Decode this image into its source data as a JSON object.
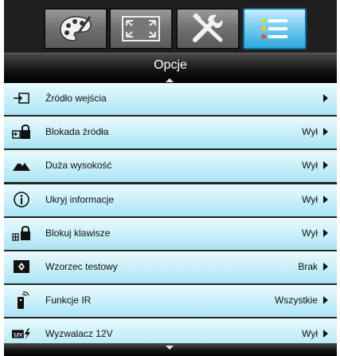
{
  "tabs": [
    {
      "name": "image-settings-tab",
      "icon": "palette-icon",
      "active": false
    },
    {
      "name": "display-tab",
      "icon": "screen-frame-icon",
      "active": false
    },
    {
      "name": "setup-tab",
      "icon": "tools-icon",
      "active": false
    },
    {
      "name": "options-tab",
      "icon": "menu-list-icon",
      "active": true
    }
  ],
  "header": {
    "title": "Opcje"
  },
  "menu": {
    "items": [
      {
        "label": "Źródło wejścia",
        "value": "",
        "icon": "input-source-icon"
      },
      {
        "label": "Blokada źródła",
        "value": "Wył",
        "icon": "source-lock-icon"
      },
      {
        "label": "Duża wysokość",
        "value": "Wył",
        "icon": "high-altitude-icon"
      },
      {
        "label": "Ukryj informacje",
        "value": "Wył",
        "icon": "info-icon"
      },
      {
        "label": "Blokuj klawisze",
        "value": "Wył",
        "icon": "keypad-lock-icon"
      },
      {
        "label": "Wzorzec testowy",
        "value": "Brak",
        "icon": "test-pattern-icon"
      },
      {
        "label": "Funkcje IR",
        "value": "Wszystkie",
        "icon": "ir-remote-icon"
      },
      {
        "label": "Wyzwalacz 12V",
        "value": "Wył",
        "icon": "trigger-12v-icon"
      }
    ]
  },
  "colors": {
    "accent": "#2fa9df",
    "row_light": "#eaf9fd",
    "row_dark": "#a9e4f4",
    "bar": "#111111"
  }
}
